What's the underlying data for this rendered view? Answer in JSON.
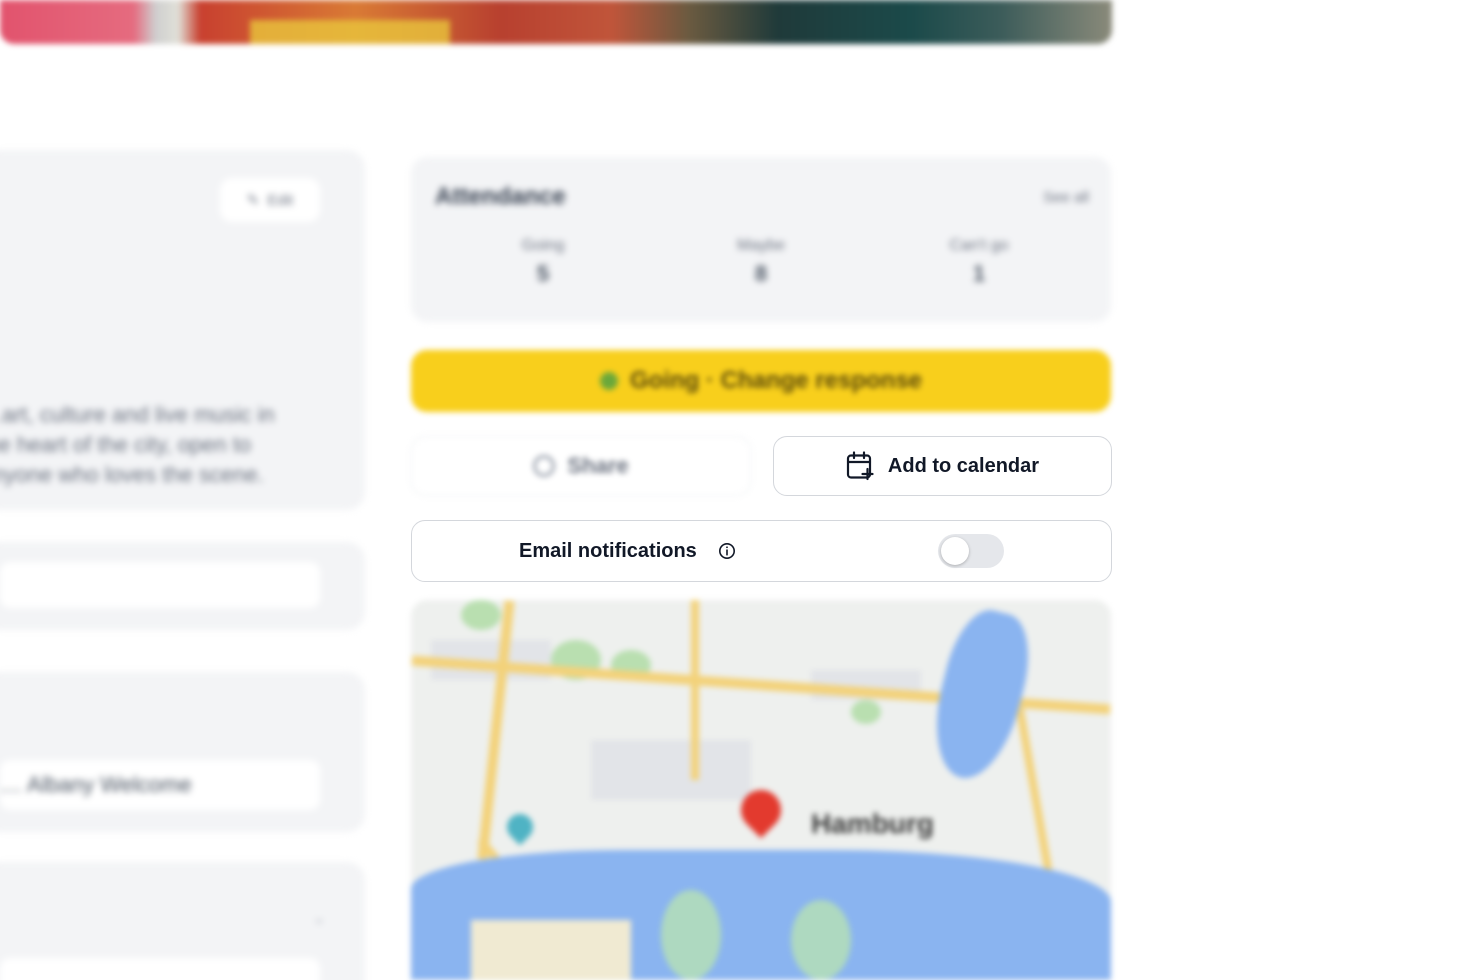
{
  "hero": {
    "image_alt": "event cover photo"
  },
  "left_column": {
    "edit_label": "Edit",
    "description": "…art, culture and live music in the heart of the city, open to anyone who loves the scene.",
    "location_field": "… Albany Welcome"
  },
  "attendance": {
    "title": "Attendance",
    "link_label": "See all",
    "stats": [
      {
        "label": "Going",
        "value": "5"
      },
      {
        "label": "Maybe",
        "value": "8"
      },
      {
        "label": "Can't go",
        "value": "1"
      }
    ]
  },
  "actions": {
    "going_label": "Going · Change response",
    "share_label": "Share",
    "add_to_calendar_label": "Add to calendar"
  },
  "notifications": {
    "label": "Email notifications",
    "enabled": false
  },
  "map": {
    "city_label": "Hamburg"
  },
  "colors": {
    "accent_yellow": "#f8cf1c",
    "border": "#d4d7dc",
    "card_bg": "#f3f4f6",
    "text_primary": "#111827",
    "toggle_off": "#e5e7eb"
  },
  "icons": {
    "calendar": "calendar-plus-icon",
    "info": "info-icon",
    "share": "share-icon",
    "edit": "pencil-icon",
    "pin": "map-pin-icon"
  }
}
